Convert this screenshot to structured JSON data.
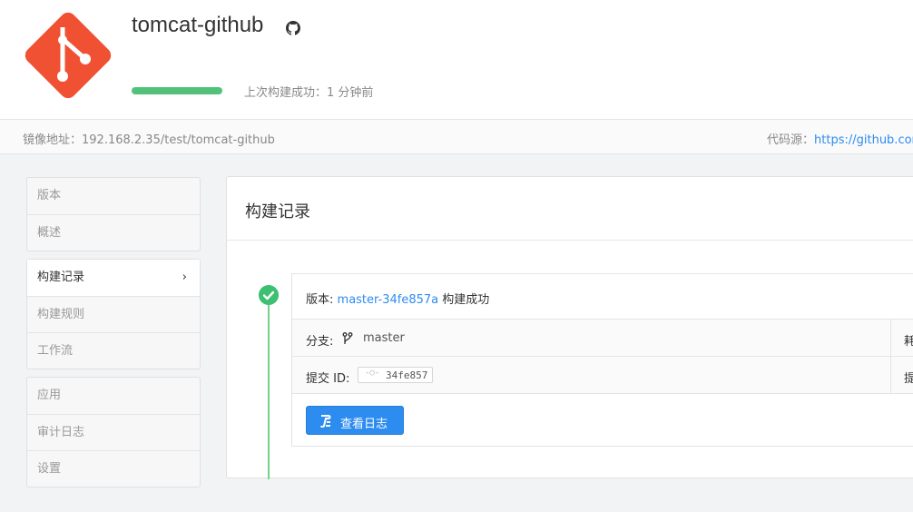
{
  "header": {
    "repo_name": "tomcat-github",
    "status_text": "上次构建成功：1 分钟前",
    "progress": 1.0,
    "accent": "#52c27a"
  },
  "info_bar": {
    "mirror_label": "镜像地址：",
    "mirror_value": "192.168.2.35/test/tomcat-github",
    "source_label": "代码源：",
    "source_value": "https://github.com/"
  },
  "sidebar": {
    "group1": [
      {
        "label": "版本"
      },
      {
        "label": "概述"
      }
    ],
    "group2": [
      {
        "label": "构建记录",
        "active": true
      },
      {
        "label": "构建规则"
      },
      {
        "label": "工作流"
      }
    ],
    "group3": [
      {
        "label": "应用"
      },
      {
        "label": "审计日志"
      },
      {
        "label": "设置"
      }
    ]
  },
  "panel": {
    "title": "构建记录",
    "build": {
      "version_label": "版本:",
      "version": "master-34fe857a",
      "status": "构建成功",
      "branch_label": "分支:",
      "branch": "master",
      "commit_label": "提交 ID:",
      "commit_icon": "-○-",
      "commit": "34fe857",
      "right_label_1": "耗",
      "right_label_2": "提",
      "log_button": "查看日志"
    }
  },
  "icons": {
    "logo": "git-logo-icon",
    "github": "github-icon",
    "check": "check-circle-icon",
    "branch": "branch-icon",
    "chevron": "chevron-right-icon"
  },
  "colors": {
    "brand": "#f05133",
    "link": "#2d8cf0",
    "success": "#3dc072"
  }
}
